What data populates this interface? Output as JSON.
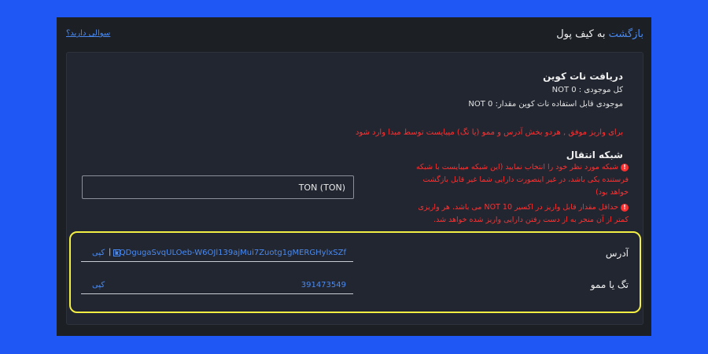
{
  "header": {
    "back_link": "بازگشت",
    "back_suffix": "به کیف پول",
    "help_link": "سوالی دارید؟"
  },
  "panel": {
    "title": "دریافت نات کوین",
    "total_balance": "کل موجودی : NOT 0",
    "usable_balance": "موجودی قابل استفاده نات کوین مقدار: NOT 0",
    "warning": "برای واریز موفق , هردو بخش آدرس و ممو (یا تگ) میبایست توسط مبدا وارد شود",
    "network_label": "شبکه انتقال",
    "network_value": "TON (TON)",
    "note1": "شبکه مورد نظر خود را انتخاب نمایید (این شبکه میبایست با شبکه فرستنده یکی باشد، در غیر اینصورت دارایی شما غیر قابل بازگشت خواهد بود)",
    "note2": "حداقل مقدار قابل واریز در اکسیر NOT 10 می باشد. هر واریزی کمتر از آن منجر به از دست رفتن دارایی واریز شده خواهد شد.",
    "address_label": "آدرس",
    "address_value": "EQDgugaSvqULOeb-W6OJl139ajMui7Zuotg1gMERGHylxSZf",
    "memo_label": "تگ یا ممو",
    "memo_value": "391473549",
    "copy_label": "کپی",
    "separator": "|"
  },
  "colors": {
    "background": "#1f57f5",
    "window": "#1c1f24",
    "panel": "#222630",
    "link": "#4a8af0",
    "warning": "#ff3030",
    "highlight": "#f3ee44"
  },
  "icons": {
    "alert": "exclamation-circle-icon",
    "qr": "qr-code-icon"
  }
}
